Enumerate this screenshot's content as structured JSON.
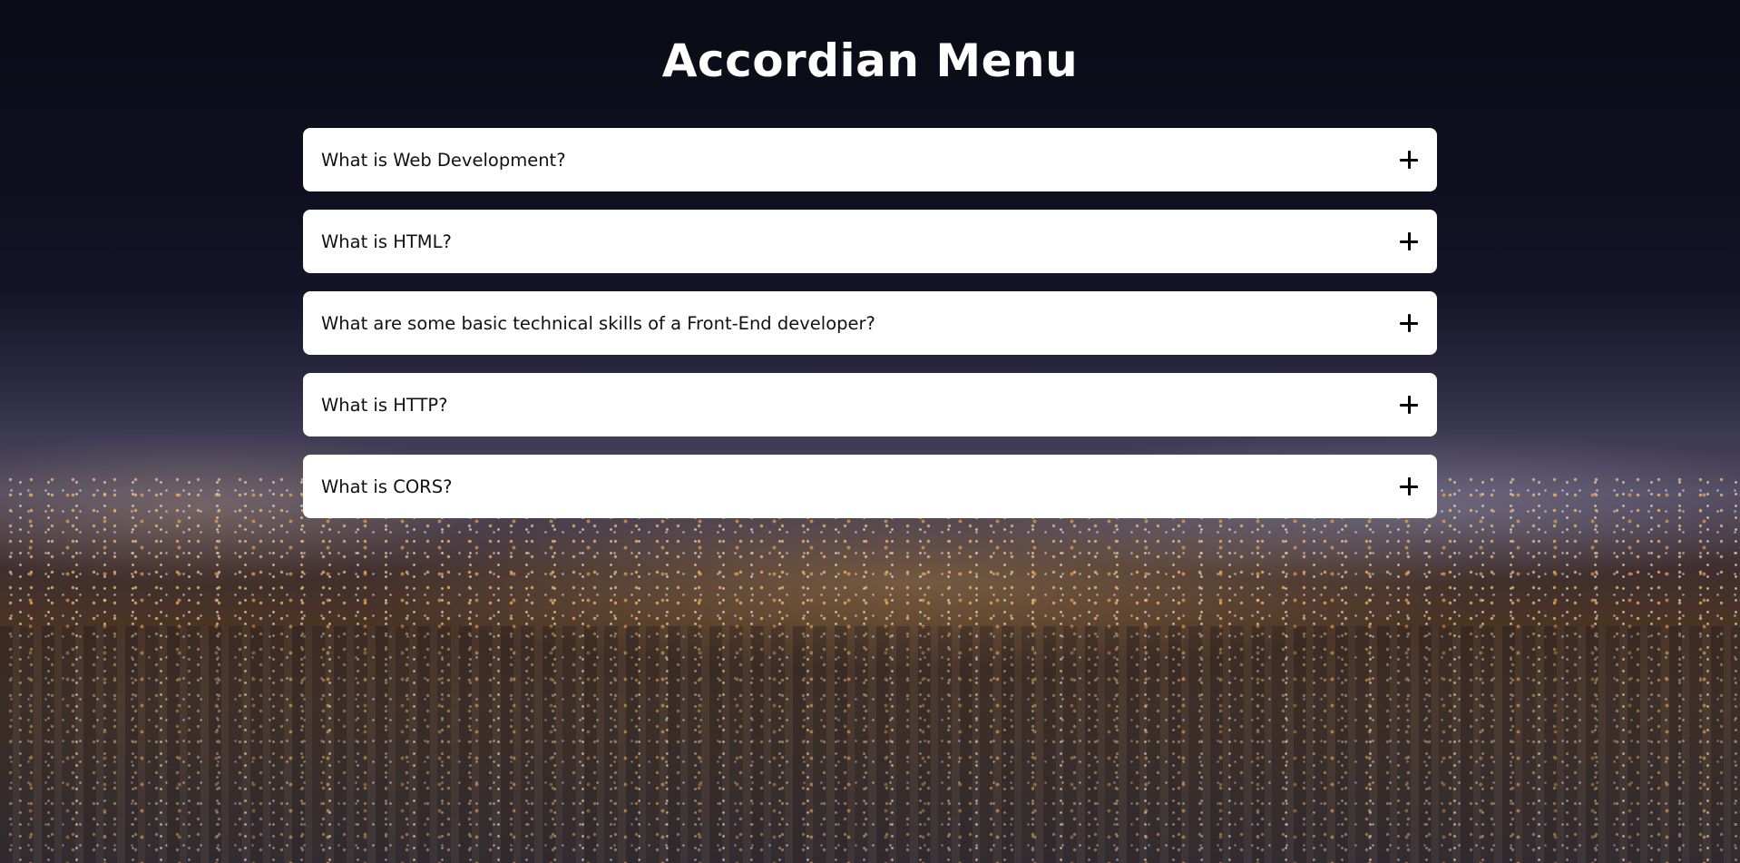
{
  "page": {
    "title": "Accordian Menu"
  },
  "accordion": {
    "items": [
      {
        "question": "What is Web Development?",
        "icon": "plus-icon"
      },
      {
        "question": "What is HTML?",
        "icon": "plus-icon"
      },
      {
        "question": "What are some basic technical skills of a Front-End developer?",
        "icon": "plus-icon"
      },
      {
        "question": "What is HTTP?",
        "icon": "plus-icon"
      },
      {
        "question": "What is CORS?",
        "icon": "plus-icon"
      }
    ]
  },
  "colors": {
    "card_background": "#ffffff",
    "title_text": "#ffffff",
    "question_text": "#111111",
    "icon": "#000000"
  }
}
